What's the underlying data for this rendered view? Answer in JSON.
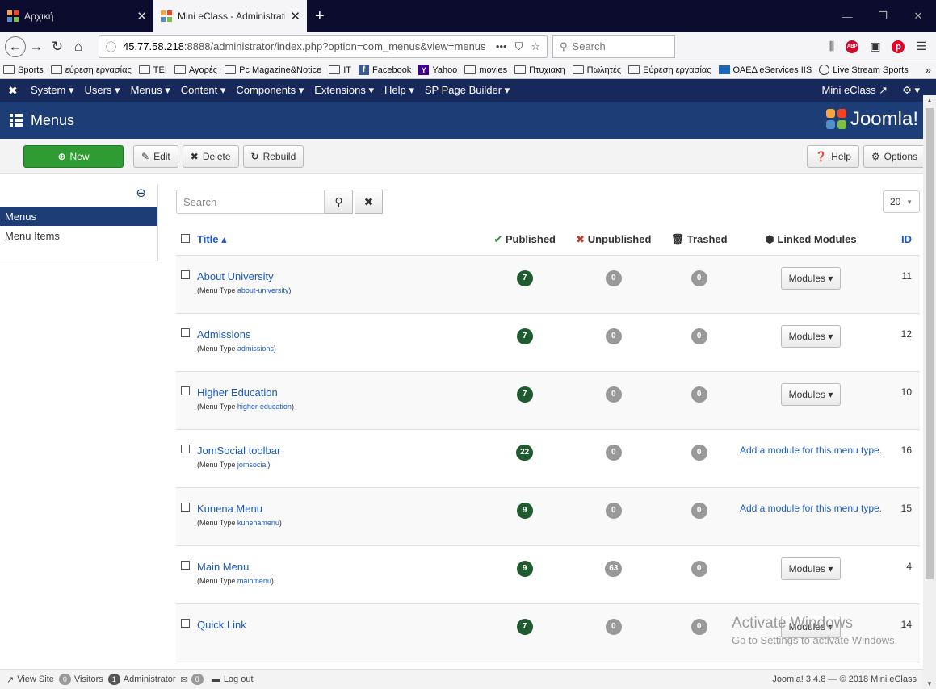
{
  "browser": {
    "tabs": [
      {
        "title": "Αρχική",
        "active": false
      },
      {
        "title": "Mini eClass - Administration - |",
        "active": true
      }
    ],
    "url_host": "45.77.58.218",
    "url_rest": ":8888/administrator/index.php?option=com_menus&view=menus",
    "search_placeholder": "Search",
    "bookmarks": [
      "Sports",
      "εύρεση εργασίας",
      "TEI",
      "Αγορές",
      "Pc Magazine&Notice",
      "IT",
      "Facebook",
      "Yahoo",
      "movies",
      "Πτυχιακη",
      "Πωλητές",
      "Εύρεση εργασίας",
      "ΟΑΕΔ eServices IIS",
      "Live Stream Sports"
    ]
  },
  "joomla_nav": {
    "items": [
      "System ▾",
      "Users ▾",
      "Menus ▾",
      "Content ▾",
      "Components ▾",
      "Extensions ▾",
      "Help ▾",
      "SP Page Builder ▾"
    ],
    "site_link": "Mini eClass ↗",
    "settings": "⚙ ▾"
  },
  "page_title": "Menus",
  "brand": "Joomla!",
  "toolbar": {
    "new": "New",
    "edit": "Edit",
    "delete": "Delete",
    "rebuild": "Rebuild",
    "help": "Help",
    "options": "Options"
  },
  "sidebar": {
    "items": [
      "Menus",
      "Menu Items"
    ]
  },
  "filter": {
    "search_placeholder": "Search",
    "limit": "20"
  },
  "table": {
    "headers": {
      "title": "Title ▴",
      "published": "Published",
      "unpublished": "Unpublished",
      "trashed": "Trashed",
      "linked": "Linked Modules",
      "id": "ID"
    },
    "rows": [
      {
        "title": "About University",
        "type_label": "(Menu Type ",
        "type": "about-university",
        "published": "7",
        "unpublished": "0",
        "trashed": "0",
        "module": "Modules ▾",
        "id": "11"
      },
      {
        "title": "Admissions",
        "type_label": "(Menu Type ",
        "type": "admissions",
        "published": "7",
        "unpublished": "0",
        "trashed": "0",
        "module": "Modules ▾",
        "id": "12"
      },
      {
        "title": "Higher Education",
        "type_label": "(Menu Type ",
        "type": "higher-education",
        "published": "7",
        "unpublished": "0",
        "trashed": "0",
        "module": "Modules ▾",
        "id": "10"
      },
      {
        "title": "JomSocial toolbar",
        "type_label": "(Menu Type ",
        "type": "jomsocial",
        "published": "22",
        "unpublished": "0",
        "trashed": "0",
        "add_module": "Add a module for this menu type.",
        "id": "16"
      },
      {
        "title": "Kunena Menu",
        "type_label": "(Menu Type ",
        "type": "kunenamenu",
        "published": "9",
        "unpublished": "0",
        "trashed": "0",
        "add_module": "Add a module for this menu type.",
        "id": "15"
      },
      {
        "title": "Main Menu",
        "type_label": "(Menu Type ",
        "type": "mainmenu",
        "published": "9",
        "unpublished": "63",
        "trashed": "0",
        "module": "Modules ▾",
        "id": "4"
      },
      {
        "title": "Quick Link",
        "published": "7",
        "unpublished": "0",
        "trashed": "0",
        "module": "Modules ▾",
        "id": "14"
      }
    ]
  },
  "watermark": {
    "line1": "Activate Windows",
    "line2": "Go to Settings to activate Windows."
  },
  "statusbar": {
    "view_site": "View Site",
    "visitors_count": "0",
    "visitors": "Visitors",
    "admin_count": "1",
    "admin": "Administrator",
    "msg_count": "0",
    "logout": "Log out",
    "version": "Joomla! 3.4.8 — © 2018 Mini eClass"
  }
}
